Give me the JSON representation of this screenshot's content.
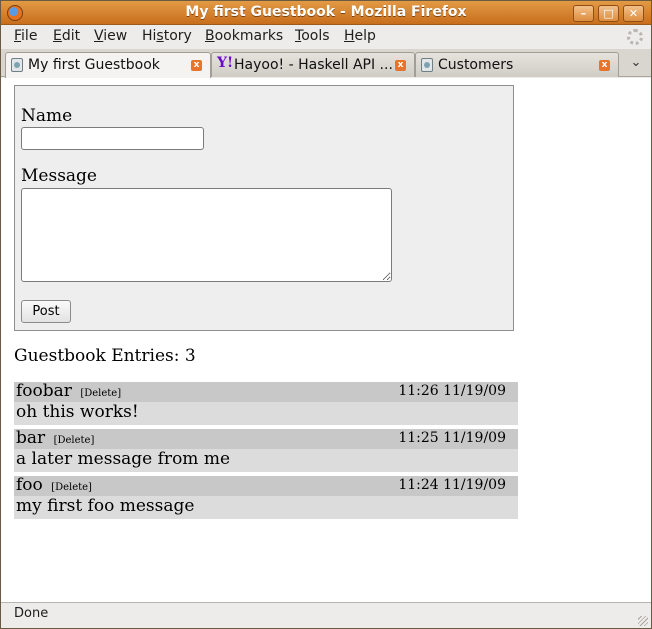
{
  "window": {
    "title": "My first Guestbook - Mozilla Firefox",
    "controls": {
      "minimize": "–",
      "maximize": "□",
      "close": "✕"
    }
  },
  "menu": [
    {
      "label": "File",
      "key": "F",
      "rest": "ile"
    },
    {
      "label": "Edit",
      "key": "E",
      "rest": "dit"
    },
    {
      "label": "View",
      "key": "V",
      "rest": "iew"
    },
    {
      "label": "History",
      "key": "s",
      "pre": "Hi",
      "rest": "tory"
    },
    {
      "label": "Bookmarks",
      "key": "B",
      "rest": "ookmarks"
    },
    {
      "label": "Tools",
      "key": "T",
      "rest": "ools"
    },
    {
      "label": "Help",
      "key": "H",
      "rest": "elp"
    }
  ],
  "tabs": [
    {
      "label": "My first Guestbook",
      "active": true,
      "icon": "page-icon"
    },
    {
      "label": "Hayoo! - Haskell API ...",
      "active": false,
      "icon": "yahoo-icon",
      "icon_glyph": "Y!"
    },
    {
      "label": "Customers",
      "active": false,
      "icon": "page-icon"
    }
  ],
  "tab_close_glyph": "x",
  "tab_list_glyph": "⌄",
  "form": {
    "name_label": "Name",
    "name_value": "",
    "message_label": "Message",
    "message_value": "",
    "post_label": "Post"
  },
  "guestbook": {
    "entries_title": "Guestbook Entries: 3",
    "delete_label": "[Delete]",
    "entries": [
      {
        "author": "foobar",
        "time": "11:26 11/19/09",
        "message": "oh this works!"
      },
      {
        "author": "bar",
        "time": "11:25 11/19/09",
        "message": "a later message from me"
      },
      {
        "author": "foo",
        "time": "11:24 11/19/09",
        "message": "my first foo message"
      }
    ]
  },
  "status": {
    "text": "Done"
  },
  "colors": {
    "titlebar": "#d37e2c",
    "form_bg": "#eeeeee",
    "entry_head": "#c8c8c8",
    "entry_body": "#dcdcdc",
    "tab_close": "#e8742c"
  }
}
